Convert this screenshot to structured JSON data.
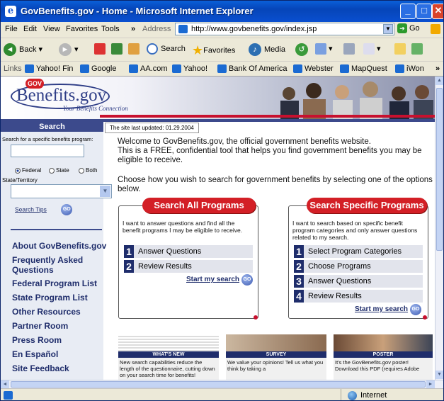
{
  "window": {
    "title": "GovBenefits.gov - Home - Microsoft Internet Explorer"
  },
  "menu": {
    "items": [
      "File",
      "Edit",
      "View",
      "Favorites",
      "Tools"
    ],
    "chevron": "»",
    "address_label": "Address",
    "url": "http://www.govbenefits.gov/index.jsp",
    "go_label": "Go"
  },
  "toolbar": {
    "back": "Back",
    "search": "Search",
    "favorites": "Favorites",
    "media": "Media"
  },
  "links_bar": {
    "label": "Links",
    "items": [
      "Yahoo! Fin",
      "Google",
      "AA.com",
      "Yahoo!",
      "Bank Of America",
      "Webster",
      "MapQuest",
      "iWon"
    ],
    "chevron": "»"
  },
  "site": {
    "logo_badge": "GOV",
    "logo_name": "Benefits.gov",
    "tagline": "Your Benefits Connection",
    "last_updated": "The site last updated: 01.29.2004"
  },
  "sidebar": {
    "search_heading": "Search",
    "search_label": "Search for a specific benefits program:",
    "radios": [
      "Federal",
      "State",
      "Both"
    ],
    "state_label": "State/Territory",
    "search_tips": "Search Tips",
    "go": "GO",
    "nav": [
      "About GovBenefits.gov",
      "Frequently Asked",
      "Questions",
      "Federal Program List",
      "State Program List",
      "Other Resources",
      "Partner Room",
      "Press Room",
      "En Español",
      "Site Feedback"
    ]
  },
  "main": {
    "intro_1": "Welcome to GovBenefits.gov, the official government benefits website.",
    "intro_2": "This is a FREE, confidential tool that helps you find government benefits you may be eligible to receive.",
    "choose": "Choose how you wish to search for government benefits by selecting one of the options below.",
    "all": {
      "title": "Search All Programs",
      "desc": "I want to answer questions and find all the benefit programs I may be eligible to receive.",
      "steps": [
        {
          "n": "1",
          "label": "Answer Questions"
        },
        {
          "n": "2",
          "label": "Review Results"
        }
      ],
      "start": "Start my search"
    },
    "specific": {
      "title": "Search Specific Programs",
      "desc": "I want to search based on specific benefit program categories and only answer questions related to my search.",
      "steps": [
        {
          "n": "1",
          "label": "Select Program Categories"
        },
        {
          "n": "2",
          "label": "Choose Programs"
        },
        {
          "n": "3",
          "label": "Answer Questions"
        },
        {
          "n": "4",
          "label": "Review Results"
        }
      ],
      "start": "Start my search"
    },
    "promos": [
      {
        "title": "WHAT'S NEW",
        "body": "New search capabilities reduce the length of the questionnaire, cutting down on your search time for benefits!"
      },
      {
        "title": "SURVEY",
        "body": "We value your opinions! Tell us what you think by taking a"
      },
      {
        "title": "POSTER",
        "body": "It's the GovBenefits.gov poster! Download this PDF (requires Adobe"
      }
    ]
  },
  "status": {
    "zone": "Internet"
  }
}
